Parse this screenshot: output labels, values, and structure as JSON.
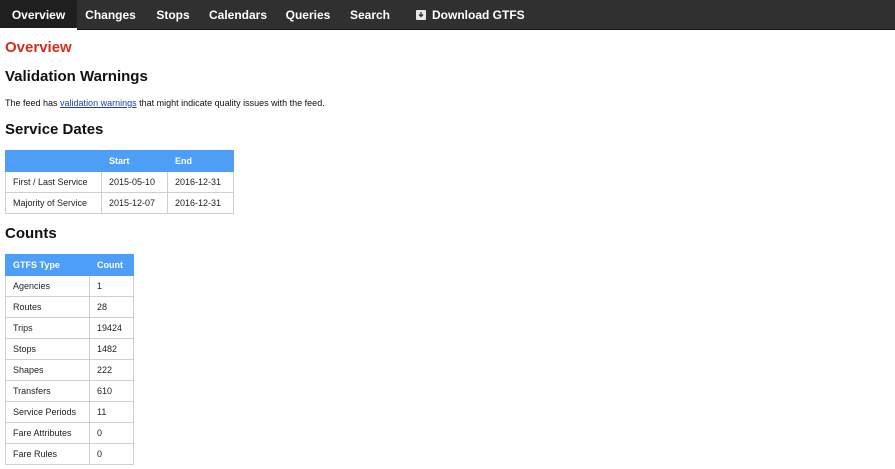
{
  "nav": {
    "items": [
      {
        "label": "Overview"
      },
      {
        "label": "Changes"
      },
      {
        "label": "Stops"
      },
      {
        "label": "Calendars"
      },
      {
        "label": "Queries"
      },
      {
        "label": "Search"
      },
      {
        "label": "Download GTFS",
        "icon": "download-icon"
      }
    ],
    "active": "Overview"
  },
  "page_title": "Overview",
  "validation": {
    "heading": "Validation Warnings",
    "text_before": "The feed has ",
    "link": "validation warnings",
    "text_after": " that might indicate quality issues with the feed."
  },
  "service_dates": {
    "heading": "Service Dates",
    "columns": [
      "",
      "Start",
      "End"
    ],
    "rows": [
      [
        "First / Last Service",
        "2015-05-10",
        "2016-12-31"
      ],
      [
        "Majority of Service",
        "2015-12-07",
        "2016-12-31"
      ]
    ]
  },
  "counts": {
    "heading": "Counts",
    "columns": [
      "GTFS Type",
      "Count"
    ],
    "rows": [
      [
        "Agencies",
        "1"
      ],
      [
        "Routes",
        "28"
      ],
      [
        "Trips",
        "19424"
      ],
      [
        "Stops",
        "1482"
      ],
      [
        "Shapes",
        "222"
      ],
      [
        "Transfers",
        "610"
      ],
      [
        "Service Periods",
        "11"
      ],
      [
        "Fare Attributes",
        "0"
      ],
      [
        "Fare Rules",
        "0"
      ]
    ]
  },
  "colors": {
    "navbar": "#303030",
    "title_red": "#d32f1e",
    "table_header_blue": "#4d9ef7",
    "link_blue": "#1a3fb5"
  }
}
